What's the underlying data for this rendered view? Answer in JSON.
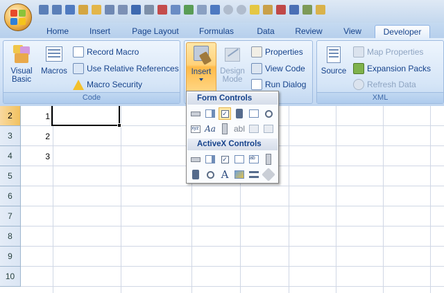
{
  "tabs": [
    "Home",
    "Insert",
    "Page Layout",
    "Formulas",
    "Data",
    "Review",
    "View",
    "Developer"
  ],
  "code_group": {
    "label": "Code",
    "visual_basic": "Visual Basic",
    "macros": "Macros",
    "record_macro": "Record Macro",
    "use_relative": "Use Relative References",
    "macro_security": "Macro Security"
  },
  "controls_group": {
    "insert": "Insert",
    "design_mode": "Design Mode",
    "properties": "Properties",
    "view_code": "View Code",
    "run_dialog": "Run Dialog"
  },
  "xml_group": {
    "label": "XML",
    "source": "Source",
    "map_properties": "Map Properties",
    "expansion_packs": "Expansion Packs",
    "refresh_data": "Refresh Data"
  },
  "dropdown": {
    "form_controls": "Form Controls",
    "activex_controls": "ActiveX Controls",
    "form_items": [
      "button-icon",
      "combo-box-icon",
      "check-box-icon",
      "spin-button-icon",
      "list-box-icon",
      "option-button-icon",
      "group-box-icon",
      "label-icon",
      "scroll-bar-icon",
      "text-field-icon",
      "combo-list-edit-icon",
      "combo-drop-down-edit-icon"
    ],
    "activex_items": [
      "command-button-icon",
      "combo-box-icon",
      "check-box-icon",
      "list-box-icon",
      "text-box-icon",
      "scroll-bar-icon",
      "spin-button-icon",
      "option-button-icon",
      "label-icon",
      "image-icon",
      "toggle-button-icon",
      "more-controls-icon"
    ]
  },
  "rows": [
    {
      "num": "2",
      "a": "1"
    },
    {
      "num": "3",
      "a": "2"
    },
    {
      "num": "4",
      "a": "3"
    },
    {
      "num": "5",
      "a": ""
    },
    {
      "num": "6",
      "a": ""
    },
    {
      "num": "7",
      "a": ""
    },
    {
      "num": "8",
      "a": ""
    },
    {
      "num": "9",
      "a": ""
    },
    {
      "num": "10",
      "a": ""
    }
  ],
  "colors": {
    "accent": "#15428b",
    "active_tab": "#ffbb4a"
  }
}
